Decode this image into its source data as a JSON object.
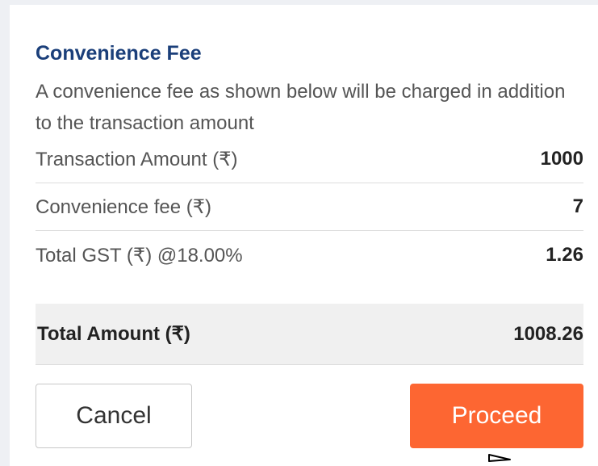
{
  "fee_dialog": {
    "title": "Convenience Fee",
    "description": "A convenience fee as shown below will be charged in addition to the transaction amount",
    "rows": [
      {
        "label": "Transaction Amount (₹)",
        "value": "1000"
      },
      {
        "label": "Convenience fee (₹)",
        "value": "7"
      },
      {
        "label": "Total GST (₹) @18.00%",
        "value": "1.26"
      }
    ],
    "total": {
      "label": "Total Amount (₹)",
      "value": "1008.26"
    },
    "buttons": {
      "cancel_label": "Cancel",
      "proceed_label": "Proceed"
    }
  },
  "colors": {
    "title": "#1b3f7a",
    "proceed_bg": "#fd6632",
    "total_bg": "#f0f0f0"
  },
  "icons": {
    "cursor": "mouse-pointer-icon"
  }
}
